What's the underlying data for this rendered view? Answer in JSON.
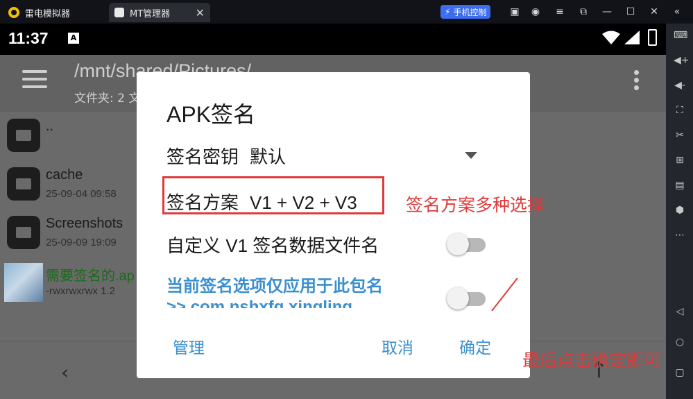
{
  "emulator": {
    "tab1_label": "雷电模拟器",
    "tab2_label": "MT管理器",
    "tab_close": "✕",
    "phone_control_label": "手机控制",
    "window_icons": [
      "gift-icon",
      "account-icon",
      "menu-icon",
      "popout-icon",
      "minimize-icon",
      "maximize-icon",
      "close-icon",
      "collapse-icon"
    ],
    "side_icons": [
      "keyboard-icon",
      "volume-up-icon",
      "volume-down-icon",
      "fullscreen-icon",
      "scissors-icon",
      "add-app-icon",
      "apk-install-icon",
      "settings-icon",
      "more-icon",
      "back-nav-icon",
      "home-nav-icon",
      "recents-nav-icon"
    ]
  },
  "status": {
    "time": "11:37",
    "notification_letter": "A"
  },
  "app": {
    "path": "/mnt/shared/Pictures/",
    "folder_count": "文件夹: 2  文"
  },
  "files": [
    {
      "name": "..",
      "meta": ""
    },
    {
      "name": "cache",
      "meta": "25-09-04 09:58"
    },
    {
      "name": "Screenshots",
      "meta": "25-09-09 19:09"
    },
    {
      "name": "需要签名的.ap",
      "meta": "-rwxrwxrwx  1.2"
    }
  ],
  "dialog": {
    "title": "APK签名",
    "key_label": "签名密钥",
    "key_value": "默认",
    "scheme_label": "签名方案",
    "scheme_value": "V1 + V2 + V3",
    "custom_v1_label": "自定义 V1 签名数据文件名",
    "custom_v1_on": false,
    "package_option_line1": "当前签名选项仅应用于此包名",
    "package_option_line2": ">> com.nshxfg.xingling",
    "package_option_on": false,
    "manage_button": "管理",
    "cancel_button": "取消",
    "confirm_button": "确定"
  },
  "annotations": {
    "scheme_note": "签名方案多种选择",
    "confirm_note": "最后点击确定即可",
    "color": "#e03a3a"
  },
  "colors": {
    "accent": "#3a8fcf",
    "phone_control_bg": "#3c6df0"
  }
}
